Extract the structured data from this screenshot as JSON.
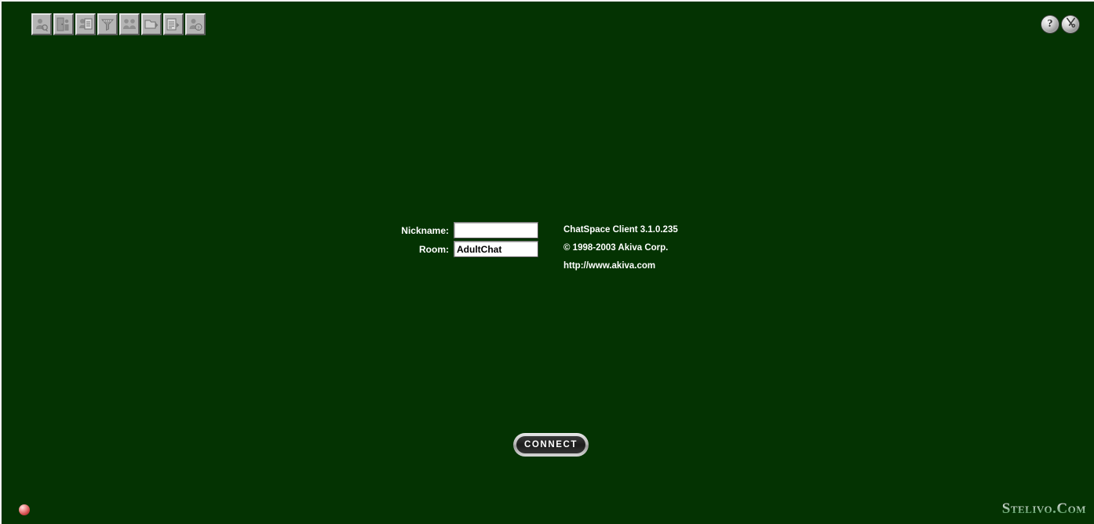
{
  "window": {
    "background_color": "#043302",
    "accent_color": "#b5b5b5"
  },
  "toolbar": {
    "buttons": [
      {
        "name": "user-profile-icon",
        "tooltip": "Profile"
      },
      {
        "name": "exit-room-icon",
        "tooltip": "Leave Room"
      },
      {
        "name": "message-list-icon",
        "tooltip": "Messages"
      },
      {
        "name": "filter-icon",
        "tooltip": "Filter"
      },
      {
        "name": "members-icon",
        "tooltip": "Members"
      },
      {
        "name": "folder-icon",
        "tooltip": "Rooms"
      },
      {
        "name": "log-icon",
        "tooltip": "Log"
      },
      {
        "name": "user-help-icon",
        "tooltip": "Who Is"
      }
    ]
  },
  "titlebar_buttons": {
    "help_glyph": "?",
    "help_name": "help-icon",
    "tools_name": "tools-icon"
  },
  "form": {
    "nickname_label": "Nickname:",
    "nickname_value": "",
    "nickname_placeholder": "",
    "room_label": "Room:",
    "room_value": "AdultChat"
  },
  "info": {
    "client": "ChatSpace Client 3.1.0.235",
    "copyright": "© 1998-2003 Akiva Corp.",
    "url": "http://www.akiva.com"
  },
  "connect": {
    "label": "CONNECT"
  },
  "status": {
    "orb_name": "connection-status-indicator",
    "orb_color": "#cf4a4a"
  },
  "watermark": {
    "text": "Stelivo.Com"
  }
}
